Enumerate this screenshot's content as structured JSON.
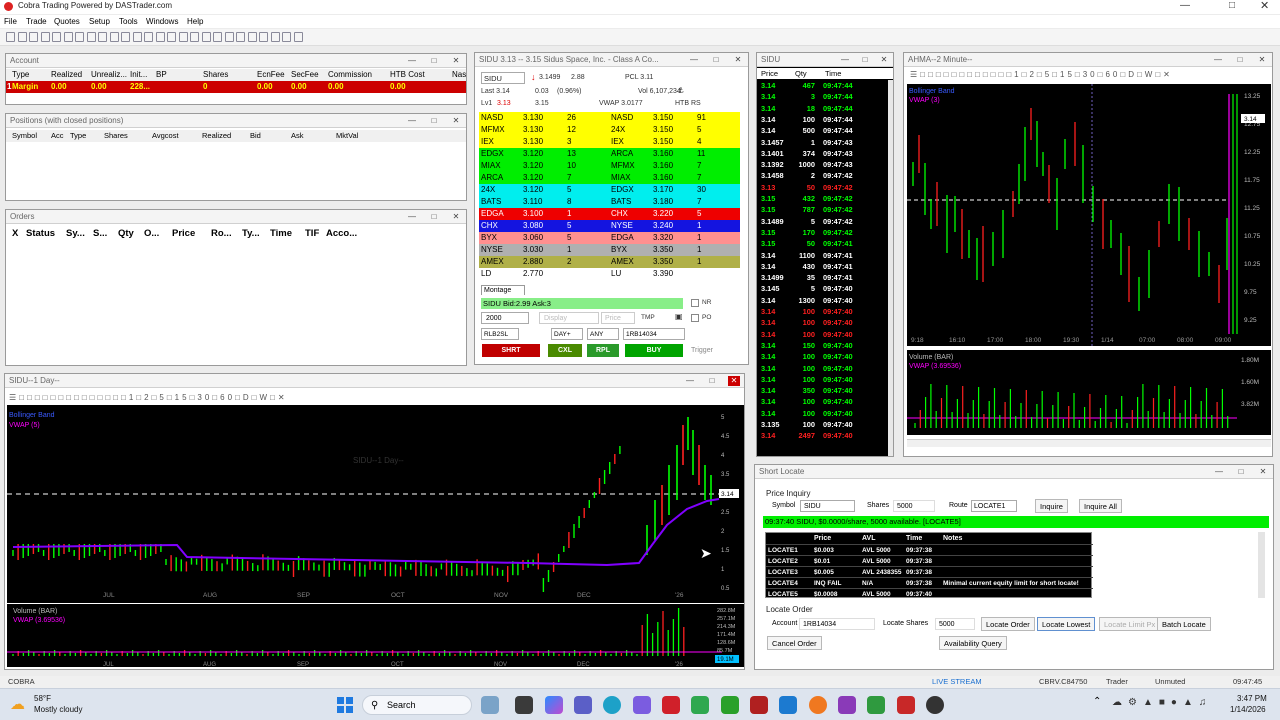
{
  "app": {
    "title": "Cobra Trading Powered by DASTrader.com"
  },
  "menu": [
    "File",
    "Trade",
    "Quotes",
    "Setup",
    "Tools",
    "Windows",
    "Help"
  ],
  "account": {
    "title": "Account",
    "headers": [
      "Type",
      "Realized",
      "Unrealiz...",
      "Init...",
      "BP",
      "Shares",
      "EcnFee",
      "SecFee",
      "Commission",
      "HTB Cost",
      "Nas"
    ],
    "row": [
      "Margin",
      "0.00",
      "0.00",
      "228...",
      "",
      "0",
      "0.00",
      "0.00",
      "0.00",
      "0.00",
      ""
    ]
  },
  "positions": {
    "title": "Positions (with closed positions)",
    "headers": [
      "Symbol",
      "Acc",
      "Type",
      "Shares",
      "Avgcost",
      "Realized",
      "Bid",
      "Ask",
      "MktVal"
    ]
  },
  "orders": {
    "title": "Orders",
    "headers": [
      "X",
      "Status",
      "Sy...",
      "S...",
      "Qty",
      "O...",
      "Price",
      "Ro...",
      "Ty...",
      "Time",
      "TIF",
      "Acco..."
    ]
  },
  "montage": {
    "title": "SIDU  3.13 -- 3.15  Sidus Space, Inc. - Class A Co...",
    "symbol": "SIDU",
    "price_box": "3.1499",
    "chg_abs": "2.88",
    "pcl": "PCL 3.11",
    "last": "Last 3.14",
    "chg": "0.03",
    "chg_pct": "(0.96%)",
    "vol": "Vol 6,107,234",
    "lvl_bid": "3.13",
    "lvl_ask": "3.15",
    "vwap": "VWAP 3.0177",
    "htb": "HTB RS",
    "bids": [
      {
        "ex": "NASD",
        "px": "3.130",
        "sz": "26"
      },
      {
        "ex": "MFMX",
        "px": "3.130",
        "sz": "12"
      },
      {
        "ex": "IEX",
        "px": "3.130",
        "sz": "3"
      },
      {
        "ex": "EDGX",
        "px": "3.120",
        "sz": "13"
      },
      {
        "ex": "MIAX",
        "px": "3.120",
        "sz": "10"
      },
      {
        "ex": "ARCA",
        "px": "3.120",
        "sz": "7"
      },
      {
        "ex": "24X",
        "px": "3.120",
        "sz": "5"
      },
      {
        "ex": "BATS",
        "px": "3.110",
        "sz": "8"
      },
      {
        "ex": "EDGA",
        "px": "3.100",
        "sz": "1"
      },
      {
        "ex": "CHX",
        "px": "3.080",
        "sz": "5"
      },
      {
        "ex": "BYX",
        "px": "3.060",
        "sz": "5"
      },
      {
        "ex": "NYSE",
        "px": "3.030",
        "sz": "1"
      },
      {
        "ex": "AMEX",
        "px": "2.880",
        "sz": "2"
      },
      {
        "ex": "LD",
        "px": "2.770",
        "sz": ""
      }
    ],
    "asks": [
      {
        "ex": "NASD",
        "px": "3.150",
        "sz": "91"
      },
      {
        "ex": "24X",
        "px": "3.150",
        "sz": "5"
      },
      {
        "ex": "IEX",
        "px": "3.150",
        "sz": "4"
      },
      {
        "ex": "ARCA",
        "px": "3.160",
        "sz": "11"
      },
      {
        "ex": "MFMX",
        "px": "3.160",
        "sz": "7"
      },
      {
        "ex": "MIAX",
        "px": "3.160",
        "sz": "7"
      },
      {
        "ex": "EDGX",
        "px": "3.170",
        "sz": "30"
      },
      {
        "ex": "BATS",
        "px": "3.180",
        "sz": "7"
      },
      {
        "ex": "CHX",
        "px": "3.220",
        "sz": "5"
      },
      {
        "ex": "NYSE",
        "px": "3.240",
        "sz": "1"
      },
      {
        "ex": "EDGA",
        "px": "3.320",
        "sz": "1"
      },
      {
        "ex": "BYX",
        "px": "3.350",
        "sz": "1"
      },
      {
        "ex": "AMEX",
        "px": "3.350",
        "sz": "1"
      },
      {
        "ex": "LU",
        "px": "3.390",
        "sz": ""
      }
    ],
    "colors": [
      "#ffff00",
      "#ffff00",
      "#ffff00",
      "#00ee00",
      "#00ee00",
      "#00ee00",
      "#00eeee",
      "#00eeee",
      "#ee0000",
      "#1414e0",
      "#ff9090",
      "#b0b0b0",
      "#b0b048",
      "#ffffff"
    ],
    "tab": "Montage",
    "order_msg": "SIDU Bid:2.99 Ask:3",
    "shares": "2000",
    "price_ph": "Price",
    "route": "RLB2SL",
    "tif": "DAY+",
    "cond": "ANY",
    "account": "1RB14034",
    "nr": "NR",
    "po": "PO",
    "tmp": "TMP",
    "display": "Display",
    "buttons": {
      "short": "SHRT",
      "cancel": "CXL",
      "replace": "RPL",
      "buy": "BUY",
      "trigger": "Trigger"
    }
  },
  "ts": {
    "title": "SIDU",
    "headers": [
      "Price",
      "Qty",
      "Time"
    ],
    "rows": [
      [
        "3.14",
        "467",
        "09:47:44",
        "g"
      ],
      [
        "3.14",
        "3",
        "09:47:44",
        "g"
      ],
      [
        "3.14",
        "18",
        "09:47:44",
        "g"
      ],
      [
        "3.14",
        "100",
        "09:47:44",
        "w"
      ],
      [
        "3.14",
        "500",
        "09:47:44",
        "w"
      ],
      [
        "3.1457",
        "1",
        "09:47:43",
        "w"
      ],
      [
        "3.1401",
        "374",
        "09:47:43",
        "w"
      ],
      [
        "3.1392",
        "1000",
        "09:47:43",
        "w"
      ],
      [
        "3.1458",
        "2",
        "09:47:42",
        "w"
      ],
      [
        "3.13",
        "50",
        "09:47:42",
        "r"
      ],
      [
        "3.15",
        "432",
        "09:47:42",
        "g"
      ],
      [
        "3.15",
        "787",
        "09:47:42",
        "g"
      ],
      [
        "3.1489",
        "5",
        "09:47:42",
        "w"
      ],
      [
        "3.15",
        "170",
        "09:47:42",
        "g"
      ],
      [
        "3.15",
        "50",
        "09:47:41",
        "g"
      ],
      [
        "3.14",
        "1100",
        "09:47:41",
        "w"
      ],
      [
        "3.14",
        "430",
        "09:47:41",
        "w"
      ],
      [
        "3.1499",
        "35",
        "09:47:41",
        "w"
      ],
      [
        "3.145",
        "5",
        "09:47:40",
        "w"
      ],
      [
        "3.14",
        "1300",
        "09:47:40",
        "w"
      ],
      [
        "3.14",
        "100",
        "09:47:40",
        "r"
      ],
      [
        "3.14",
        "100",
        "09:47:40",
        "r"
      ],
      [
        "3.14",
        "100",
        "09:47:40",
        "r"
      ],
      [
        "3.14",
        "150",
        "09:47:40",
        "g"
      ],
      [
        "3.14",
        "100",
        "09:47:40",
        "g"
      ],
      [
        "3.14",
        "100",
        "09:47:40",
        "g"
      ],
      [
        "3.14",
        "100",
        "09:47:40",
        "g"
      ],
      [
        "3.14",
        "350",
        "09:47:40",
        "g"
      ],
      [
        "3.14",
        "100",
        "09:47:40",
        "g"
      ],
      [
        "3.14",
        "100",
        "09:47:40",
        "g"
      ],
      [
        "3.135",
        "100",
        "09:47:40",
        "w"
      ],
      [
        "3.14",
        "2497",
        "09:47:40",
        "r"
      ]
    ]
  },
  "chart2": {
    "title": "AHMA--2 Minute--",
    "legend1": "Bollinger Band",
    "legend2": "VWAP (3)",
    "vol_label": "Volume (BAR)",
    "vol_legend": "VWAP (3.69536)",
    "last_tag": "3.14",
    "yticks": [
      "13.25",
      "12.75",
      "12.25",
      "11.75",
      "11.25",
      "10.75",
      "10.25",
      "9.75",
      "9.25"
    ],
    "vticks": [
      "1.80M",
      "1.60M",
      "3.82M"
    ],
    "xticks": [
      "9:18",
      "16:10",
      "17:00",
      "18:00",
      "19:30",
      "1/14",
      "07:00",
      "08:00",
      "09:00"
    ]
  },
  "chart1": {
    "title": "SIDU--1 Day--",
    "legend1": "Bollinger Band",
    "legend2": "VWAP (5)",
    "watermark": "SIDU--1 Day--",
    "vol_label": "Volume (BAR)",
    "vol_legend": "VWAP (3.69536)",
    "last_tag": "3.14",
    "vol_tag": "19.1M",
    "xticks": [
      "JUL",
      "AUG",
      "SEP",
      "OCT",
      "NOV",
      "DEC",
      "'26"
    ],
    "yticks": [
      "5",
      "4.5",
      "4",
      "3.5",
      "3",
      "2.5",
      "2",
      "1.5",
      "1",
      "0.5"
    ],
    "vticks": [
      "282.8M",
      "257.1M",
      "214.3M",
      "171.4M",
      "128.6M",
      "85.7M",
      "42.9M"
    ]
  },
  "short_locate": {
    "title": "Short Locate",
    "price_inquiry": "Price Inquiry",
    "symbol_label": "Symbol",
    "symbol": "SIDU",
    "shares_label": "Shares",
    "shares": "5000",
    "route_label": "Route",
    "route": "LOCATE1",
    "inquire": "Inquire",
    "inquire_all": "Inquire All",
    "status": "09:37:40 SIDU, $0.0000/share, 5000 available. [LOCATE5]",
    "headers": [
      "Price",
      "AVL",
      "Time",
      "Notes"
    ],
    "rows": [
      [
        "LOCATE1",
        "$0.003",
        "AVL 5000",
        "09:37:38",
        ""
      ],
      [
        "LOCATE2",
        "$0.01",
        "AVL 5000",
        "09:37:38",
        ""
      ],
      [
        "LOCATE3",
        "$0.005",
        "AVL 2438355",
        "09:37:38",
        ""
      ],
      [
        "LOCATE4",
        "INQ FAIL",
        "N/A",
        "09:37:38",
        "Minimal current equity limit for short locate!"
      ],
      [
        "LOCATE5",
        "$0.0008",
        "AVL 5000",
        "09:37:40",
        ""
      ]
    ],
    "locate_order": "Locate Order",
    "account_label": "Account",
    "account": "1RB14034",
    "locate_shares_label": "Locate Shares",
    "locate_shares": "5000",
    "btn_locate_order": "Locate Order",
    "btn_locate_lowest": "Locate Lowest",
    "btn_locate_limit": "Locate Limit Px",
    "btn_batch": "Batch Locate",
    "btn_cancel": "Cancel Order",
    "btn_avail": "Availability Query"
  },
  "statusbar": {
    "left": "COBRA",
    "live": "LIVE STREAM",
    "server": "CBRV.C84750",
    "role": "Trader",
    "state": "Unmuted",
    "time": "09:47:45"
  },
  "taskbar": {
    "temp": "58°F",
    "weather": "Mostly cloudy",
    "search": "Search",
    "clock_time": "3:47 PM",
    "clock_date": "1/14/2026"
  },
  "colors": {
    "buy": "#00a400",
    "short": "#c00000",
    "cancel": "#4a8a00",
    "replace": "#2a9a2a",
    "green": "#00ff00",
    "red": "#ff2020",
    "purple": "#8000ff",
    "magenta": "#ff00ff"
  }
}
